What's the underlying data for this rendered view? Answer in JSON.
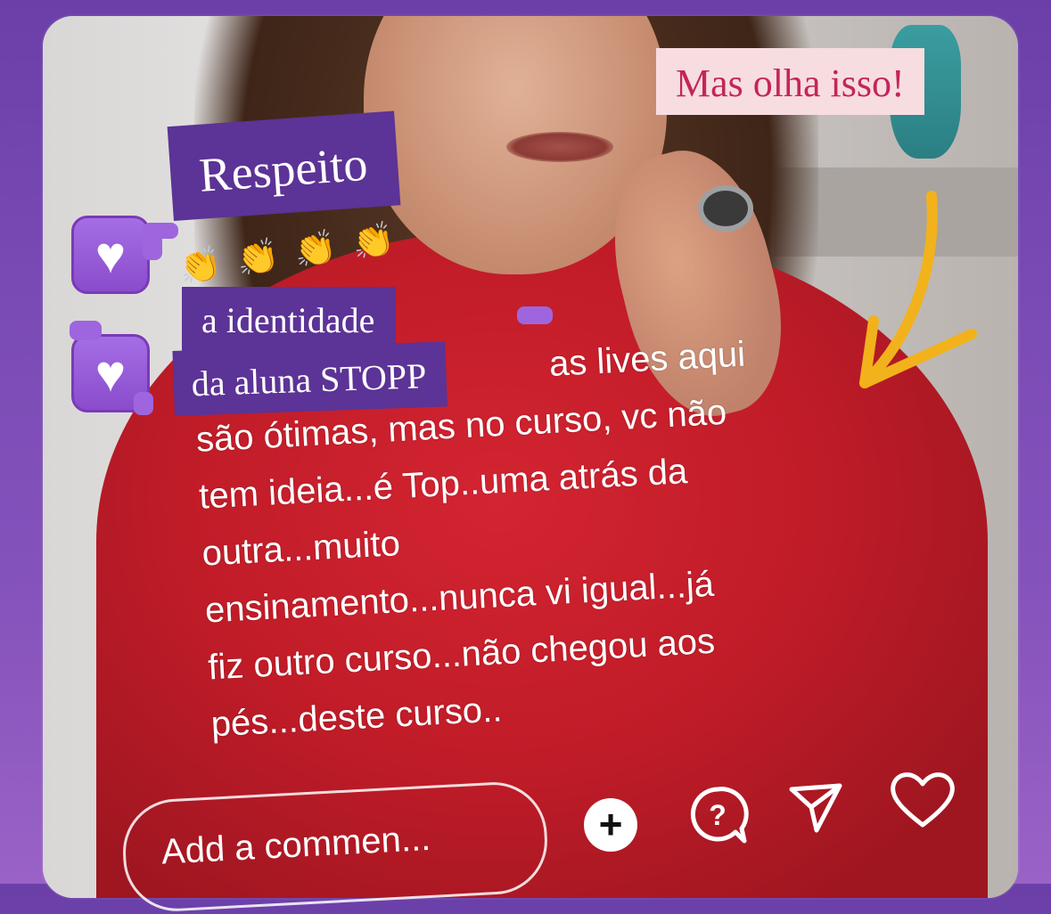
{
  "stickers": {
    "respeito": "Respeito",
    "identidade": "a identidade",
    "aluna": "da aluna STOPP",
    "mas_olha": "Mas olha isso!"
  },
  "comment_lines": [
    "as lives aqui",
    "são ótimas, mas no curso, vc não",
    "tem ideia...é Top..uma atrás da",
    "outra...muito",
    "ensinamento...nunca vi igual...já",
    "fiz outro curso...não chegou aos",
    "pés...deste curso.."
  ],
  "comment_box": {
    "placeholder": "Add a commen..."
  },
  "icons": [
    "heart-badge-icon",
    "heart-badge-icon",
    "clapping-hands-icon",
    "arrow-icon",
    "plus-icon",
    "question-icon",
    "send-icon",
    "heart-outline-icon"
  ],
  "colors": {
    "sticker_purple": "#5c3396",
    "sticker_pink_bg": "#f7dde0",
    "sticker_pink_text": "#c4255a",
    "arrow_yellow": "#f2b21b"
  }
}
